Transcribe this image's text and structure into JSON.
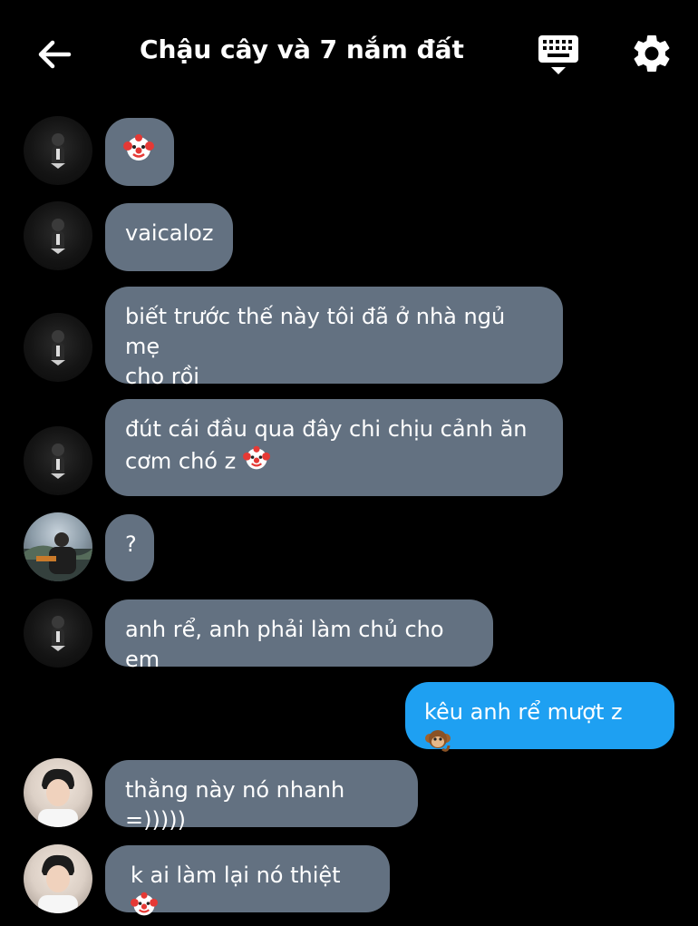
{
  "header": {
    "title": "Chậu cây và 7 nắm đất",
    "back_icon": "arrow-left-icon",
    "keyboard_icon": "keyboard-icon",
    "settings_icon": "gear-icon"
  },
  "messages": [
    {
      "sender": "other",
      "avatar": "dark-portrait",
      "text": "",
      "emoji": "clown-face"
    },
    {
      "sender": "other",
      "avatar": "dark-portrait",
      "text": "vaicaloz"
    },
    {
      "sender": "other",
      "avatar": "dark-portrait",
      "line1": "biết trước thế này tôi đã ở nhà ngủ mẹ",
      "line2": "cho rồi"
    },
    {
      "sender": "other",
      "avatar": "dark-portrait",
      "line1": "đút cái đầu qua đây chi chịu cảnh ăn",
      "line2": "cơm chó z",
      "emoji": "clown-face"
    },
    {
      "sender": "other",
      "avatar": "outdoor-portrait",
      "text": "?"
    },
    {
      "sender": "other",
      "avatar": "dark-portrait",
      "text": "anh rể, anh phải làm chủ cho em"
    },
    {
      "sender": "me",
      "text": "kêu anh rể mượt z",
      "emoji": "monkey"
    },
    {
      "sender": "other",
      "avatar": "boy-portrait",
      "text": "thằng này nó nhanh =)))))"
    },
    {
      "sender": "other",
      "avatar": "boy-portrait",
      "text": "k ai làm lại nó thiệt",
      "emoji": "clown-face"
    }
  ],
  "colors": {
    "background": "#000000",
    "received_bubble": "#637181",
    "sent_bubble": "#1ea0f2",
    "text": "#ffffff"
  }
}
